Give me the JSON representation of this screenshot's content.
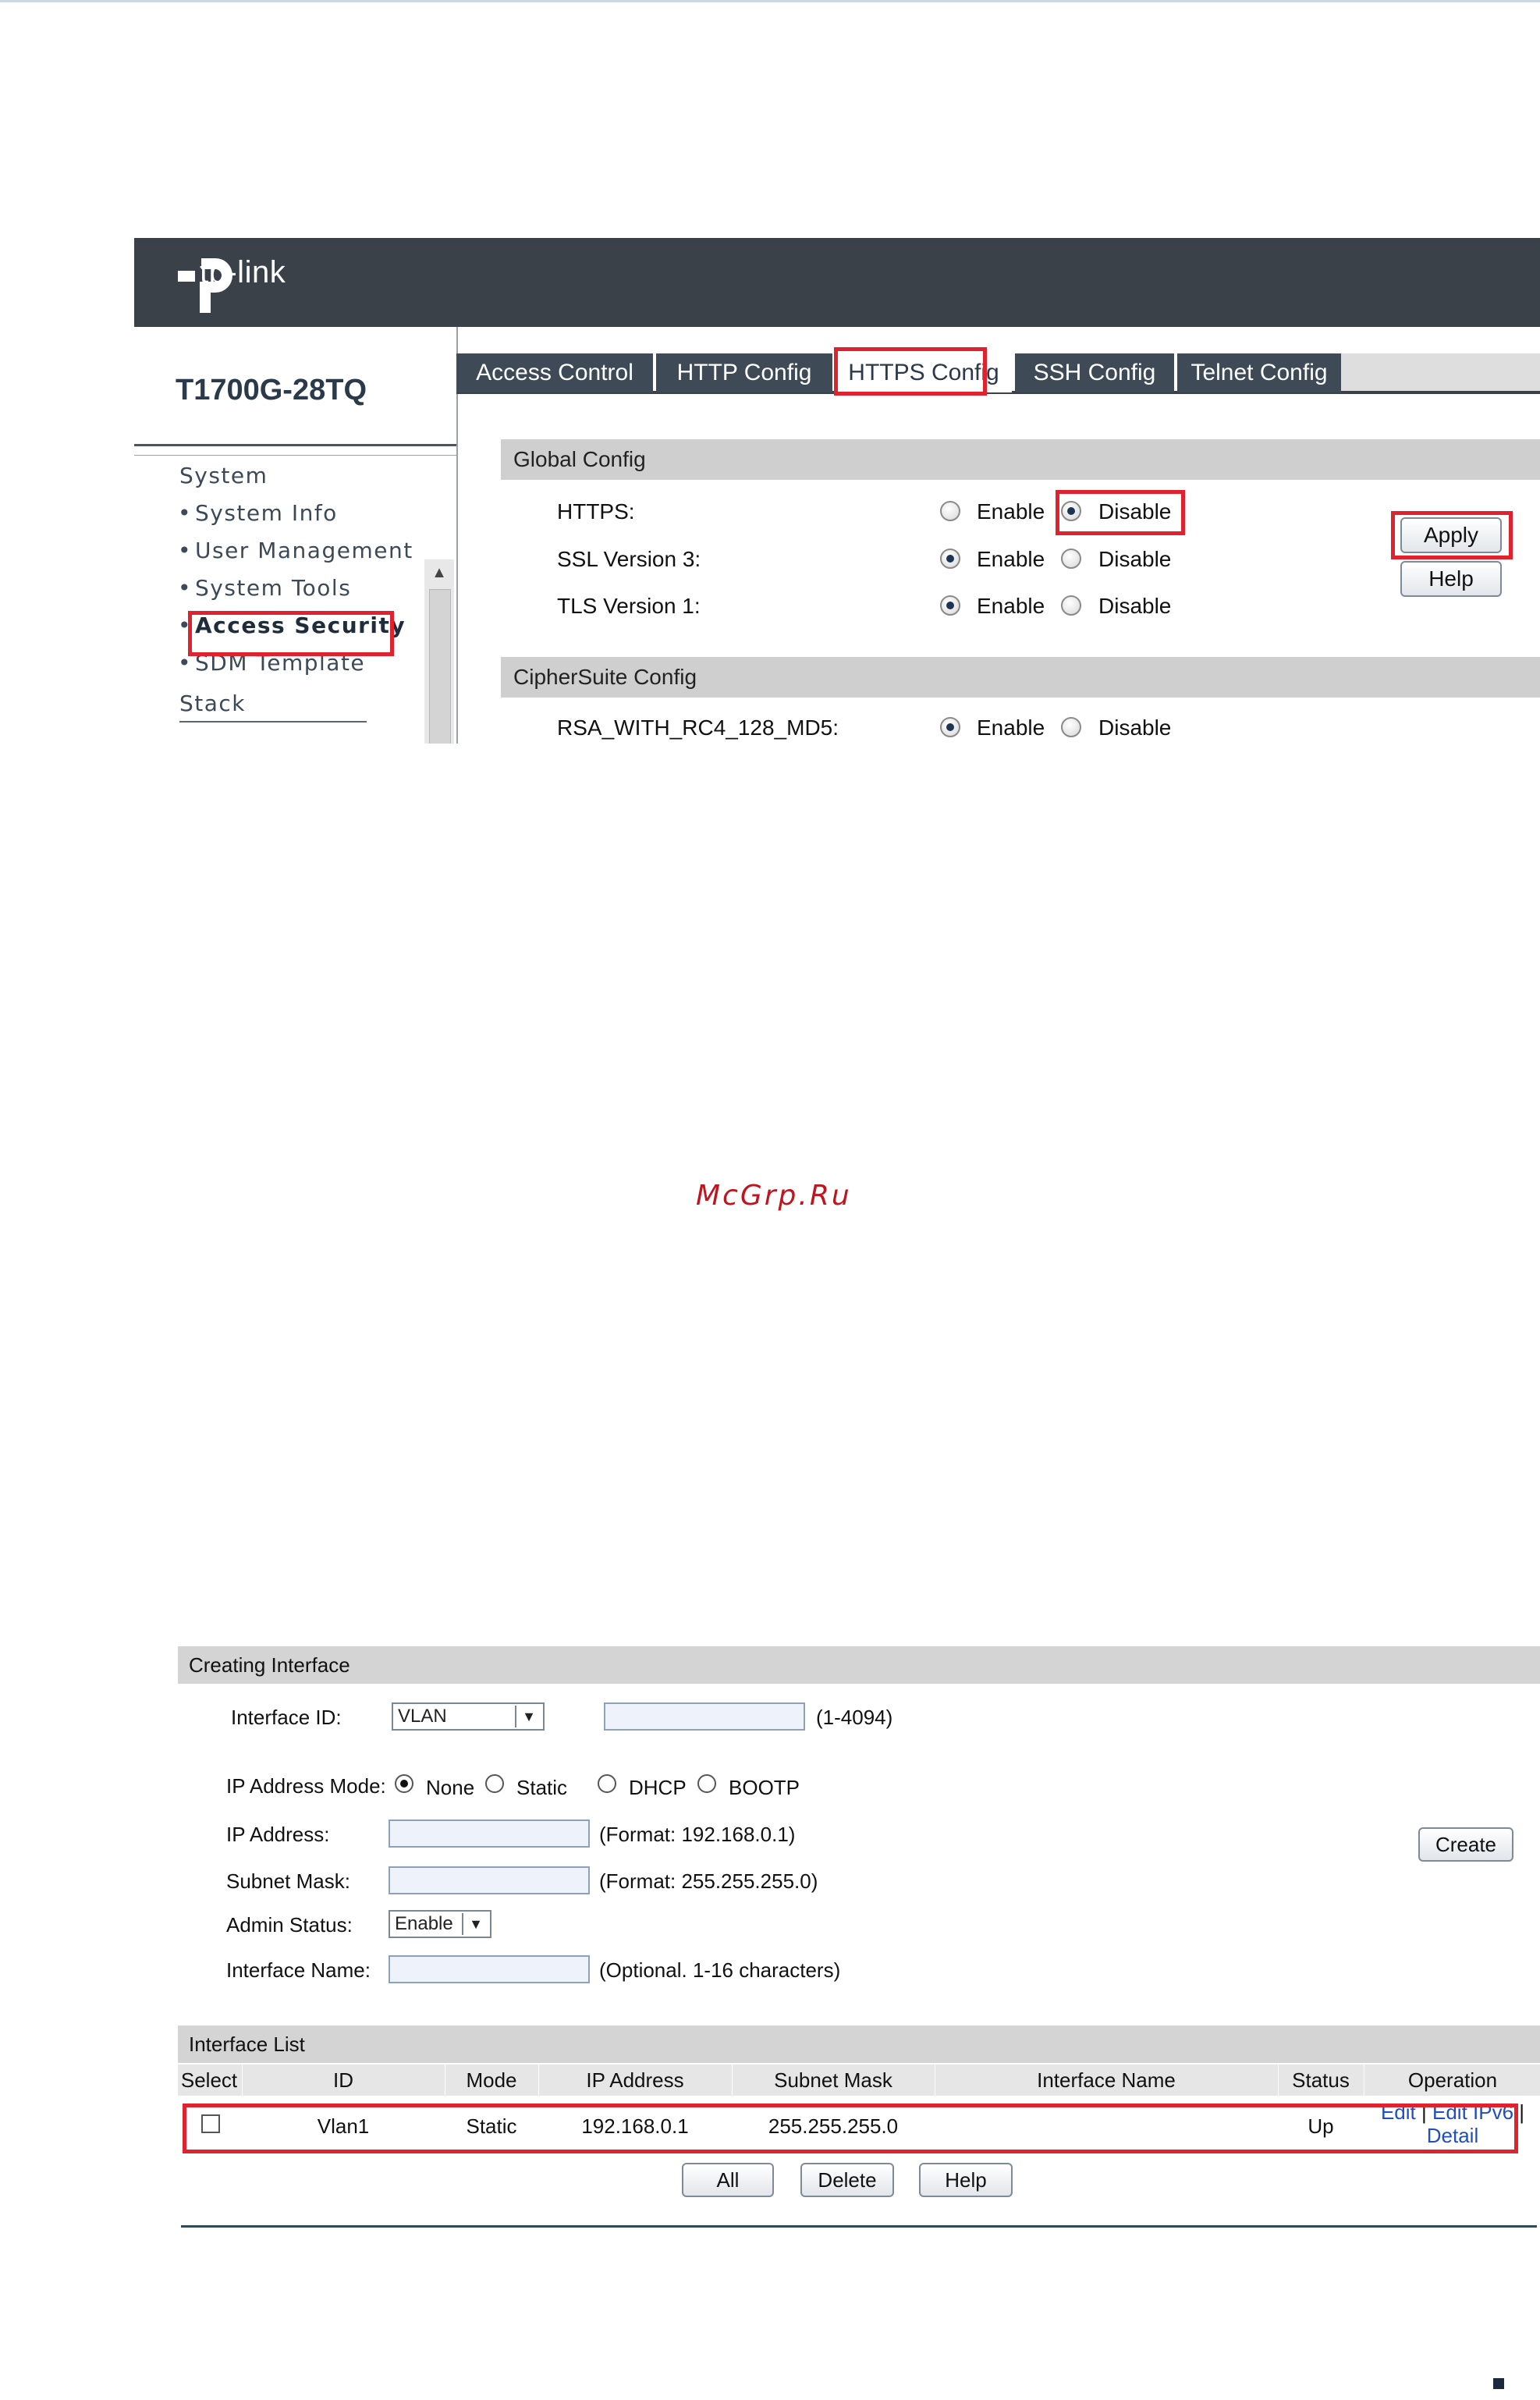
{
  "app": {
    "brand": "tp-link",
    "model": "T1700G-28TQ",
    "watermark": "McGrp.Ru"
  },
  "sidebar": {
    "items": [
      {
        "label": "System"
      },
      {
        "label": "System Info"
      },
      {
        "label": "User Management"
      },
      {
        "label": "System Tools"
      },
      {
        "label": "Access Security"
      },
      {
        "label": "SDM Template"
      },
      {
        "label": "Stack"
      }
    ]
  },
  "tabs": [
    {
      "label": "Access Control"
    },
    {
      "label": "HTTP Config"
    },
    {
      "label": "HTTPS Config"
    },
    {
      "label": "SSH Config"
    },
    {
      "label": "Telnet Config"
    }
  ],
  "global_config": {
    "title": "Global Config",
    "rows": [
      {
        "label": "HTTPS:",
        "selected": "Disable"
      },
      {
        "label": "SSL Version 3:",
        "selected": "Enable"
      },
      {
        "label": "TLS Version 1:",
        "selected": "Enable"
      }
    ],
    "enable_label": "Enable",
    "disable_label": "Disable",
    "apply_label": "Apply",
    "help_label": "Help"
  },
  "ciphersuite": {
    "title": "CipherSuite Config",
    "rows": [
      {
        "label": "RSA_WITH_RC4_128_MD5:",
        "selected": "Enable"
      }
    ]
  },
  "creating_interface": {
    "title": "Creating Interface",
    "interface_id_label": "Interface ID:",
    "interface_type": "VLAN",
    "id_range": "(1-4094)",
    "ip_mode_label": "IP Address Mode:",
    "ip_modes": [
      "None",
      "Static",
      "DHCP",
      "BOOTP"
    ],
    "ip_mode_selected": "None",
    "ip_address_label": "IP Address:",
    "ip_format": "(Format: 192.168.0.1)",
    "subnet_mask_label": "Subnet Mask:",
    "mask_format": "(Format: 255.255.255.0)",
    "admin_status_label": "Admin Status:",
    "admin_status": "Enable",
    "interface_name_label": "Interface Name:",
    "name_hint": "(Optional. 1-16 characters)",
    "create_label": "Create"
  },
  "interface_list": {
    "title": "Interface List",
    "columns": [
      "Select",
      "ID",
      "Mode",
      "IP Address",
      "Subnet Mask",
      "Interface Name",
      "Status",
      "Operation"
    ],
    "rows": [
      {
        "id": "Vlan1",
        "mode": "Static",
        "ip": "192.168.0.1",
        "mask": "255.255.255.0",
        "name": "",
        "status": "Up",
        "op_edit": "Edit",
        "op_sep1": "|",
        "op_edit_ipv6": "Edit IPv6",
        "op_sep2": "|",
        "op_detail": "Detail"
      }
    ],
    "buttons": {
      "all": "All",
      "delete": "Delete",
      "help": "Help"
    }
  },
  "colors": {
    "highlight": "#e0212e",
    "banner": "#3a4148",
    "link": "#1f4fc2"
  }
}
